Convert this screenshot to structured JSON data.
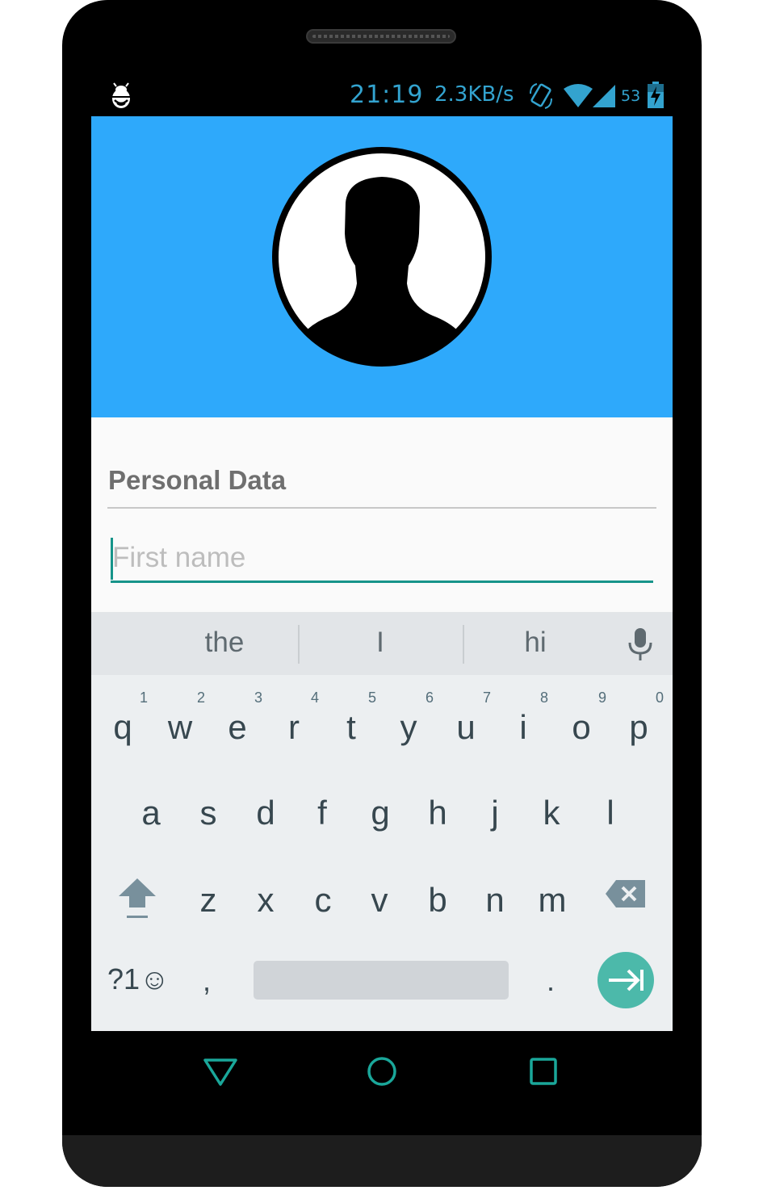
{
  "status_bar": {
    "time": "21:19",
    "network_speed": "2.3KB/s",
    "battery_percent": "53",
    "icons": [
      "debug-bug-icon",
      "rotate-icon",
      "wifi-icon",
      "cell-signal-icon",
      "battery-charging-icon"
    ],
    "color": "#33a3cf"
  },
  "header": {
    "background": "#2ea9fb",
    "avatar_icon": "person-silhouette-icon"
  },
  "form": {
    "section_title": "Personal Data",
    "first_name": {
      "value": "",
      "placeholder": "First name"
    },
    "accent": "#16948a"
  },
  "keyboard": {
    "suggestions": [
      "the",
      "I",
      "hi"
    ],
    "row1": [
      {
        "ch": "q",
        "num": "1"
      },
      {
        "ch": "w",
        "num": "2"
      },
      {
        "ch": "e",
        "num": "3"
      },
      {
        "ch": "r",
        "num": "4"
      },
      {
        "ch": "t",
        "num": "5"
      },
      {
        "ch": "y",
        "num": "6"
      },
      {
        "ch": "u",
        "num": "7"
      },
      {
        "ch": "i",
        "num": "8"
      },
      {
        "ch": "o",
        "num": "9"
      },
      {
        "ch": "p",
        "num": "0"
      }
    ],
    "row2": [
      "a",
      "s",
      "d",
      "f",
      "g",
      "h",
      "j",
      "k",
      "l"
    ],
    "row3": [
      "z",
      "x",
      "c",
      "v",
      "b",
      "n",
      "m"
    ],
    "symbols_label": "?1☺",
    "comma_label": ",",
    "period_label": ".",
    "icons": [
      "microphone-icon",
      "shift-icon",
      "backspace-icon",
      "enter-next-icon"
    ],
    "enter_color": "#4cb9aa"
  },
  "navbar": {
    "icons": [
      "back-icon",
      "home-icon",
      "recents-icon"
    ],
    "color": "#1aa79a"
  }
}
